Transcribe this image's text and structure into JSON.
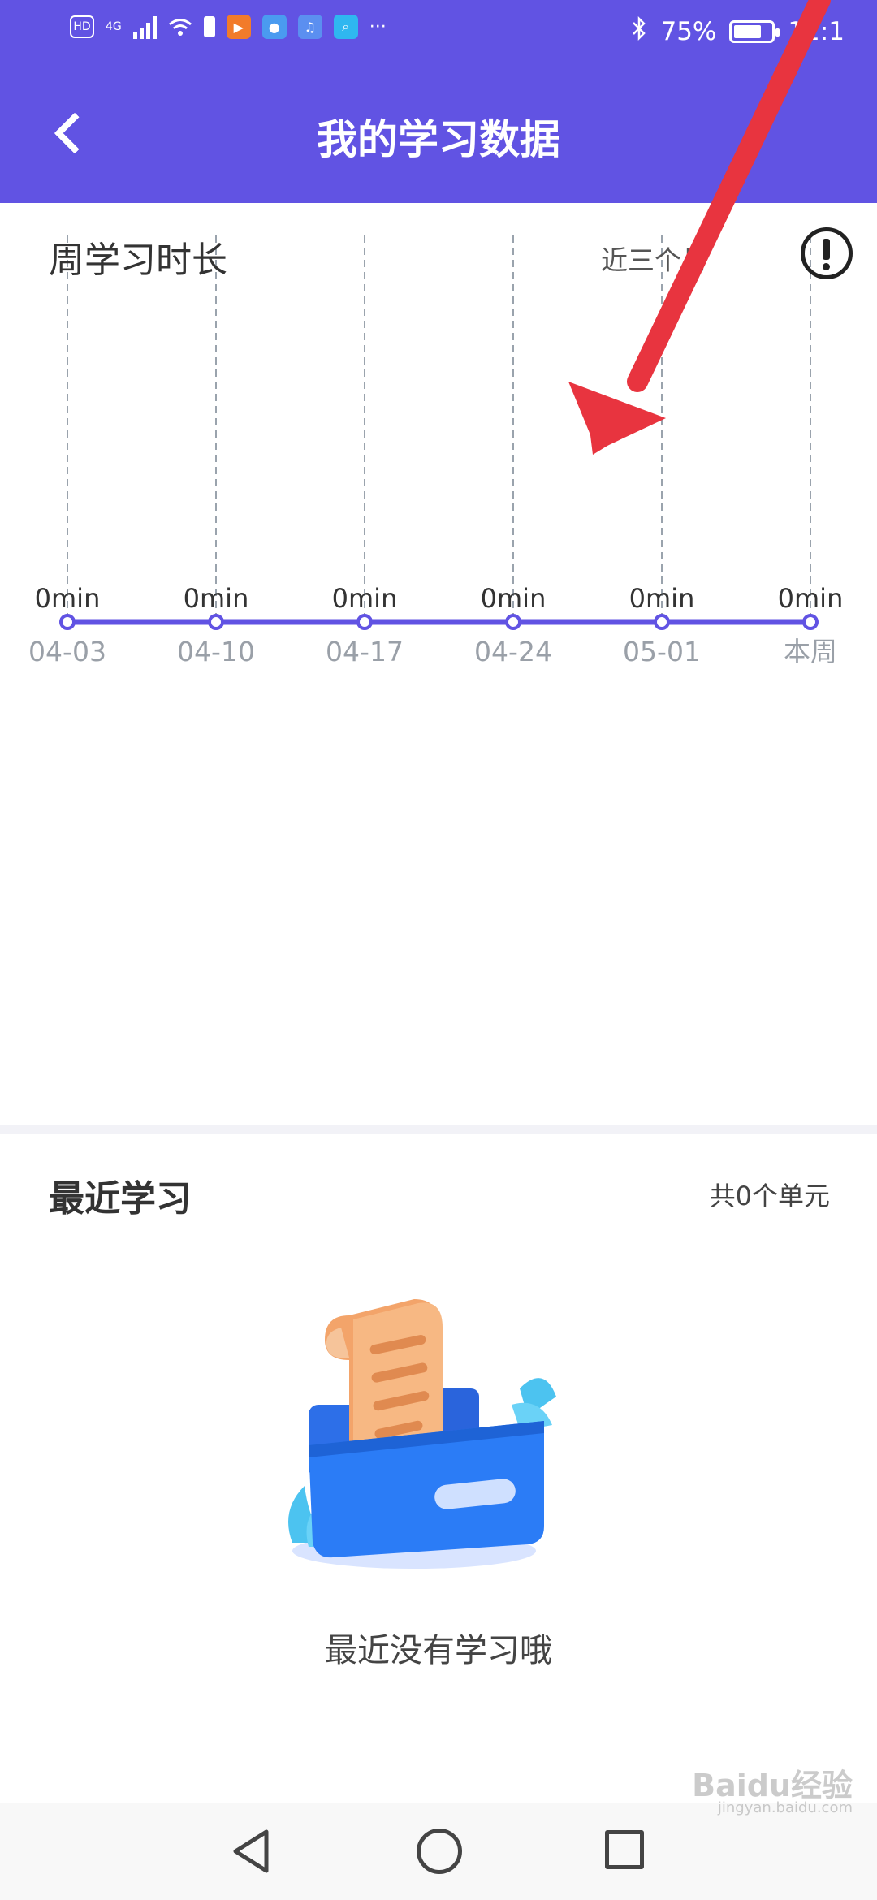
{
  "status_bar": {
    "hd": "HD",
    "network": "4G",
    "battery_text": "75%",
    "battery_level": 0.75,
    "time": "12:1"
  },
  "header": {
    "title": "我的学习数据",
    "back_icon": "chevron-left-icon"
  },
  "chart_card": {
    "title": "周学习时长",
    "range_label": "近三个月",
    "info_icon": "exclamation-circle-icon"
  },
  "chart_data": {
    "type": "line",
    "categories": [
      "04-03",
      "04-10",
      "04-17",
      "04-24",
      "05-01",
      "本周"
    ],
    "values": [
      0,
      0,
      0,
      0,
      0,
      0
    ],
    "value_labels": [
      "0min",
      "0min",
      "0min",
      "0min",
      "0min",
      "0min"
    ],
    "title": "周学习时长",
    "unit": "min",
    "grid": "vertical dashed",
    "colors": {
      "line": "#6153E3",
      "grid": "#9aa3ad"
    }
  },
  "recent": {
    "title": "最近学习",
    "count_label": "共0个单元",
    "empty_text": "最近没有学习哦",
    "illustration": "empty-box-illustration"
  },
  "nav": {
    "back_icon": "triangle-back-icon",
    "home_icon": "circle-home-icon",
    "recent_icon": "square-recents-icon"
  },
  "watermark": {
    "text": "Baidu经验",
    "sub": "jingyan.baidu.com"
  },
  "colors": {
    "accent": "#6153E3",
    "annotation_arrow": "#E8343F"
  }
}
